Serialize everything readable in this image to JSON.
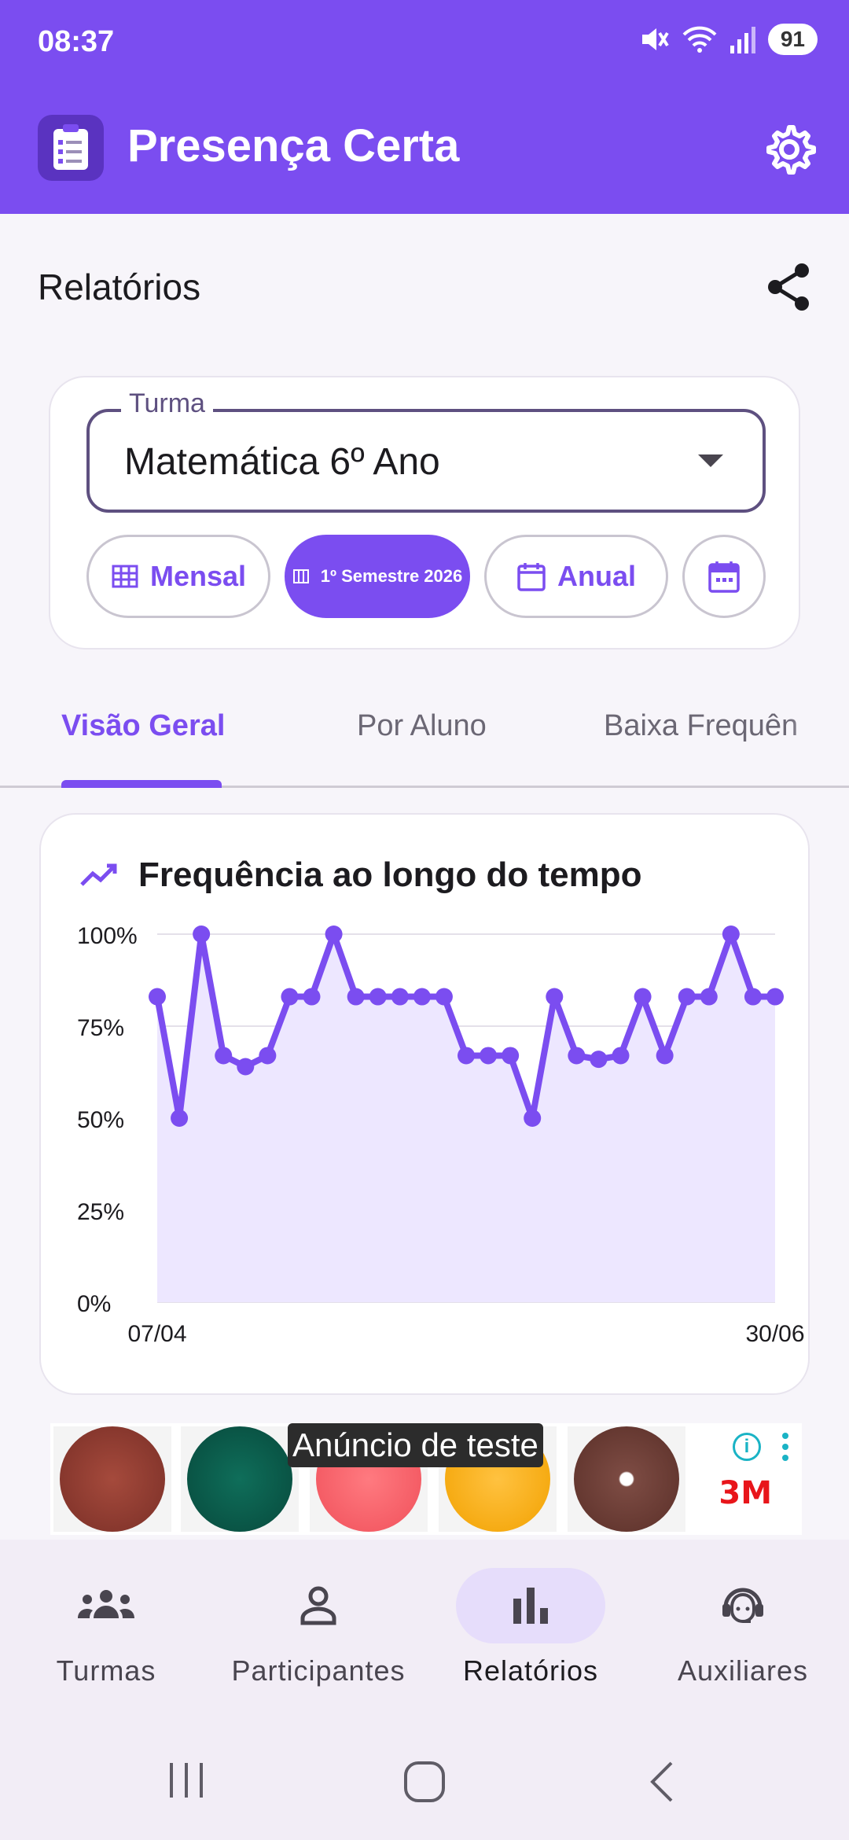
{
  "status": {
    "time": "08:37",
    "battery": "91"
  },
  "app": {
    "title": "Presença Certa"
  },
  "section": {
    "title": "Relatórios"
  },
  "filter": {
    "field_label": "Turma",
    "field_value": "Matemática 6º Ano",
    "chips": {
      "mensal": "Mensal",
      "semestre": "1º Semestre 2026",
      "anual": "Anual"
    }
  },
  "tabs": [
    {
      "label": "Visão Geral"
    },
    {
      "label": "Por Aluno"
    },
    {
      "label": "Baixa Frequên"
    }
  ],
  "chart": {
    "title": "Frequência ao longo do tempo"
  },
  "chart_data": {
    "type": "area",
    "title": "Frequência ao longo do tempo",
    "y_ticks": [
      "100%",
      "75%",
      "50%",
      "25%",
      "0%"
    ],
    "x_labels": [
      "07/04",
      "30/06"
    ],
    "ylim": [
      0,
      100
    ],
    "grid": true,
    "color": "#7b4df0",
    "fill": "#ede7ff",
    "values": [
      83,
      50,
      100,
      67,
      64,
      67,
      83,
      83,
      100,
      83,
      83,
      83,
      83,
      83,
      67,
      67,
      67,
      50,
      83,
      67,
      66,
      67,
      83,
      67,
      83,
      83,
      100,
      83,
      83
    ]
  },
  "ad": {
    "label": "Anúncio de teste",
    "brand": "3M",
    "info": "i"
  },
  "nav": {
    "items": [
      {
        "label": "Turmas"
      },
      {
        "label": "Participantes"
      },
      {
        "label": "Relatórios"
      },
      {
        "label": "Auxiliares"
      }
    ]
  }
}
